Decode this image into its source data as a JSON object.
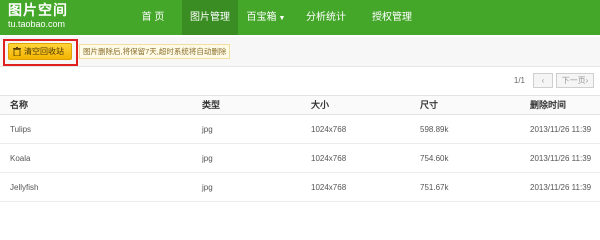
{
  "logo": {
    "title": "图片空间",
    "subtitle": "tu.taobao.com"
  },
  "nav": {
    "items": [
      {
        "label": "首 页"
      },
      {
        "label": "图片管理"
      },
      {
        "label": "百宝箱"
      },
      {
        "label": "分析统计"
      },
      {
        "label": "授权管理"
      }
    ],
    "active_index": 1,
    "dropdown_caret": "▼"
  },
  "actions": {
    "clear_recycle_label": "清空回收站",
    "notice": "图片删除后,将保留7天,超时系统将自动删除"
  },
  "pagination": {
    "count": "1/1",
    "prev": "‹",
    "next": "下一页›"
  },
  "table": {
    "columns": [
      "名称",
      "类型",
      "大小",
      "尺寸",
      "删除时间"
    ],
    "rows": [
      {
        "name": "Tulips",
        "type": "jpg",
        "size": "1024x768",
        "dimension": "598.89k",
        "deleted_at": "2013/11/26 11:39"
      },
      {
        "name": "Koala",
        "type": "jpg",
        "size": "1024x768",
        "dimension": "754.60k",
        "deleted_at": "2013/11/26 11:39"
      },
      {
        "name": "Jellyfish",
        "type": "jpg",
        "size": "1024x768",
        "dimension": "751.67k",
        "deleted_at": "2013/11/26 11:39"
      }
    ]
  },
  "colors": {
    "header_bg": "#45a72a",
    "active_nav_bg": "#3a8d22",
    "button_bg": "#f4b400",
    "highlight_border": "#e02020"
  }
}
